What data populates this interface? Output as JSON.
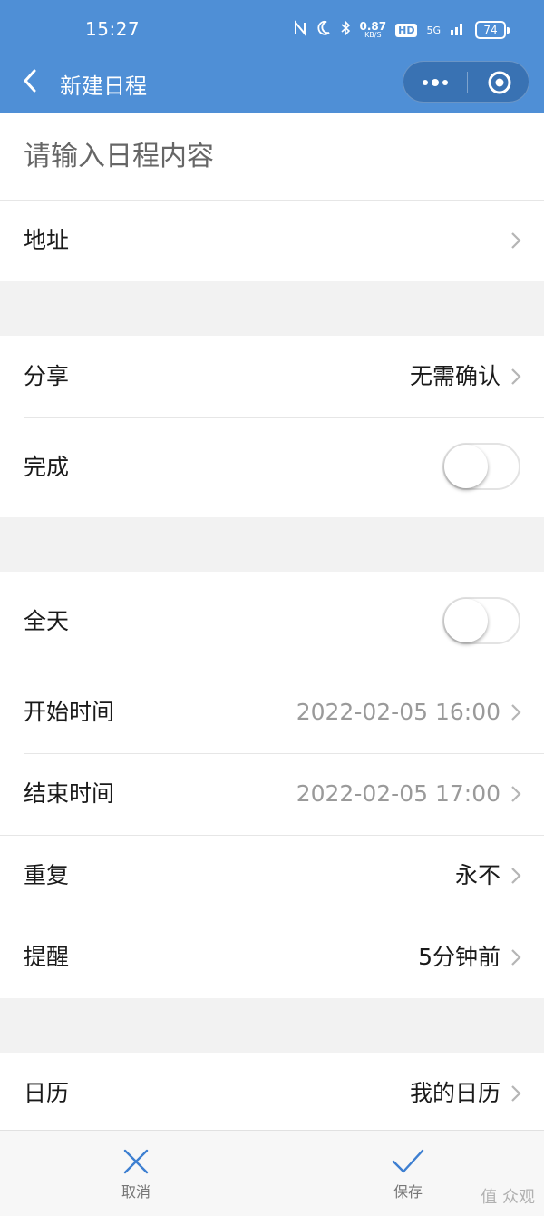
{
  "status_bar": {
    "time": "15:27",
    "net_speed_value": "0.87",
    "net_speed_unit": "KB/S",
    "hd": "HD",
    "network": "5G",
    "battery": "74"
  },
  "header": {
    "title": "新建日程",
    "bg_color": "#4f8fd6"
  },
  "form": {
    "title_placeholder": "请输入日程内容",
    "address_label": "地址",
    "share_label": "分享",
    "share_value": "无需确认",
    "done_label": "完成",
    "allday_label": "全天",
    "start_label": "开始时间",
    "start_value": "2022-02-05 16:00",
    "end_label": "结束时间",
    "end_value": "2022-02-05 17:00",
    "repeat_label": "重复",
    "repeat_value": "永不",
    "remind_label": "提醒",
    "remind_value": "5分钟前",
    "calendar_label": "日历",
    "calendar_value": "我的日历"
  },
  "toggles": {
    "done_on": false,
    "allday_on": false
  },
  "bottom": {
    "cancel_label": "取消",
    "save_label": "保存",
    "accent_color": "#3d7fd1"
  },
  "watermark": "值 众观"
}
